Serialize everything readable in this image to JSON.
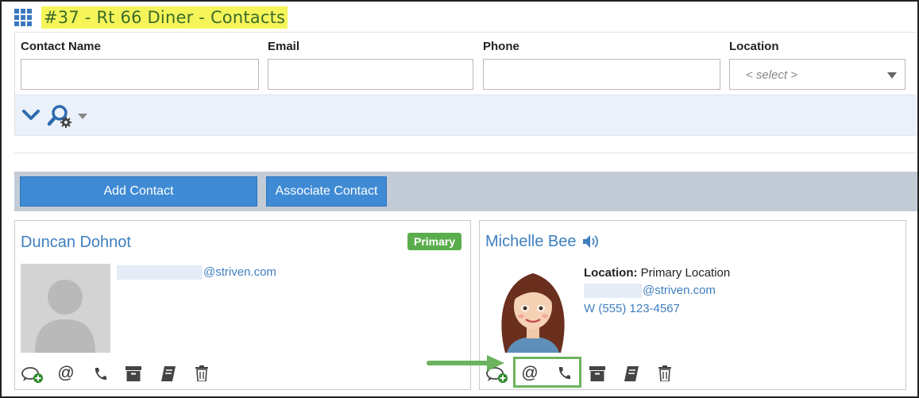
{
  "header": {
    "title": "#37 - Rt 66 Diner - Contacts"
  },
  "filters": {
    "contact_name_label": "Contact Name",
    "email_label": "Email",
    "phone_label": "Phone",
    "location_label": "Location",
    "location_placeholder": "< select >"
  },
  "actions": {
    "add_contact": "Add Contact",
    "associate_contact": "Associate Contact"
  },
  "contacts": [
    {
      "name": "Duncan Dohnot",
      "badge": "Primary",
      "email_domain": "@striven.com"
    },
    {
      "name": "Michelle Bee",
      "location_label": "Location:",
      "location_value": "Primary Location",
      "email_domain": "@striven.com",
      "phone": "W (555) 123-4567"
    }
  ],
  "colors": {
    "accent_blue": "#3f8ad4",
    "title_highlight": "#f5f55a",
    "primary_badge": "#5aad4c",
    "annotation_green": "#6cb35e"
  }
}
